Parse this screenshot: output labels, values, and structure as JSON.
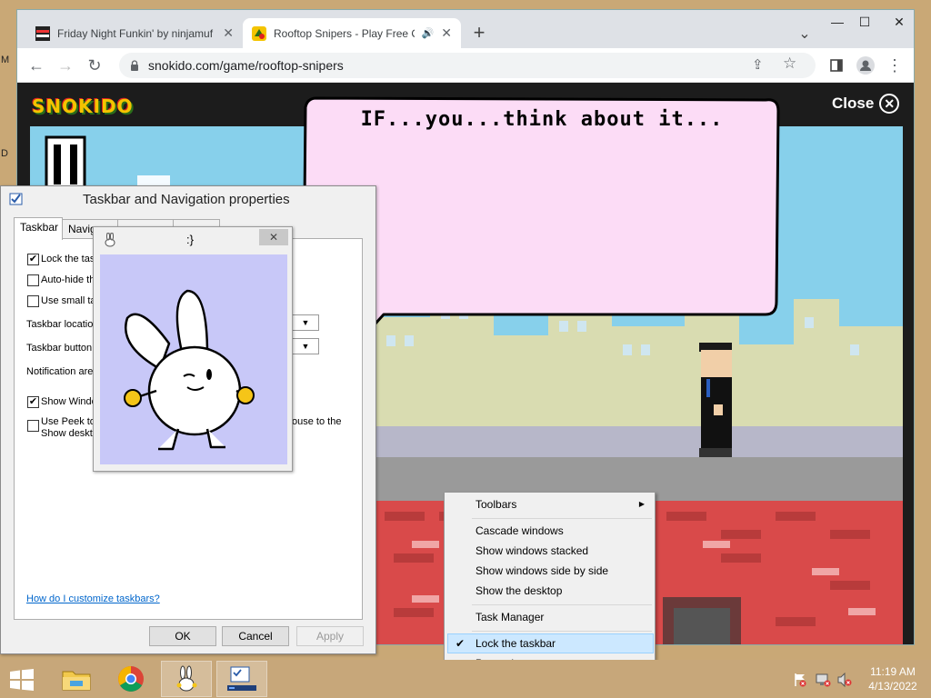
{
  "browser": {
    "tabs": [
      {
        "title": "Friday Night Funkin' by ninjamuf",
        "active": false
      },
      {
        "title": "Rooftop Snipers - Play Free O",
        "active": true
      }
    ],
    "new_tab_label": "+",
    "url": "snokido.com/game/rooftop-snipers",
    "window_controls": {
      "minimize": "—",
      "maximize": "☐",
      "close": "✕"
    },
    "tab_list_icon": "⌄"
  },
  "site": {
    "logo": "SNOKIDO",
    "close_label": "Close",
    "close_icon": "✕"
  },
  "game": {
    "speech": "IF...you...think about it..."
  },
  "desktop_edge_labels": [
    "M",
    "D"
  ],
  "dialog": {
    "title": "Taskbar and Navigation properties",
    "tabs": [
      "Taskbar",
      "Naviga",
      "",
      ""
    ],
    "options": [
      {
        "label": "Lock the tas",
        "checked": true
      },
      {
        "label": "Auto-hide th",
        "checked": false
      },
      {
        "label": "Use small ta",
        "checked": false
      }
    ],
    "fields": [
      "Taskbar locatio",
      "Taskbar button",
      "Notification are"
    ],
    "show_windows": {
      "label": "Show Windo",
      "checked": true
    },
    "peek": {
      "line1": "Use Peek to",
      "line2": "Show deskto",
      "right": "ouse to the"
    },
    "help_link": "How do I customize taskbars?",
    "buttons": {
      "ok": "OK",
      "cancel": "Cancel",
      "apply": "Apply"
    }
  },
  "popup": {
    "title": ":}",
    "close": "✕"
  },
  "context_menu": {
    "items": [
      {
        "label": "Toolbars",
        "submenu": true
      },
      {
        "label": "Cascade windows"
      },
      {
        "label": "Show windows stacked"
      },
      {
        "label": "Show windows side by side"
      },
      {
        "label": "Show the desktop"
      },
      {
        "label": "Task Manager"
      },
      {
        "label": "Lock the taskbar",
        "checked": true,
        "highlighted": true
      },
      {
        "label": "Properties"
      }
    ]
  },
  "taskbar": {
    "time": "11:19 AM",
    "date": "4/13/2022",
    "apps": [
      "file-explorer",
      "chrome",
      "bunny-app",
      "taskbar-properties"
    ]
  },
  "colors": {
    "sky": "#87d0eb",
    "brick": "#d94a4a",
    "popup_bg": "#c8c8f8",
    "taskbar": "#c7a77a"
  }
}
